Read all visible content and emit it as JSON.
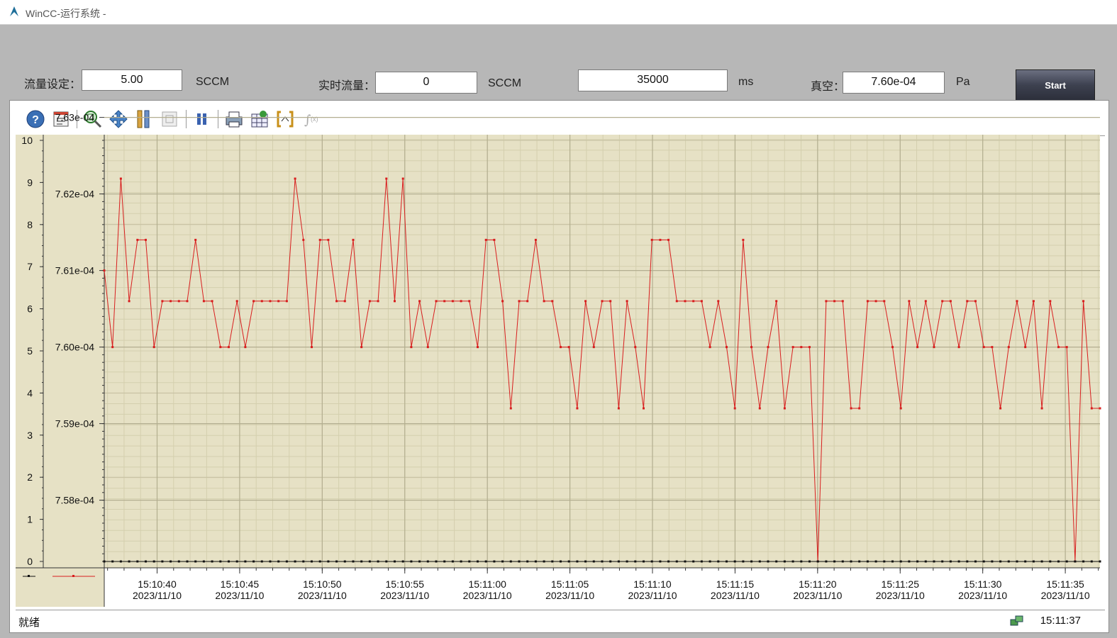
{
  "window": {
    "title": "WinCC-运行系统 -"
  },
  "controls": {
    "flow_set_label": "流量设定：",
    "flow_set_value": "5.00",
    "flow_set_unit": "SCCM",
    "flow_rt_label": "实时流量：",
    "flow_rt_value": "0",
    "flow_rt_unit": "SCCM",
    "time_value": "35000",
    "time_unit": "ms",
    "vacuum_label": "真空：",
    "vacuum_value": "7.60e-04",
    "vacuum_unit": "Pa",
    "start_label": "Start"
  },
  "toolbar": {
    "icons": [
      "help-icon",
      "config-icon",
      "zoom-area-icon",
      "move-icon",
      "zoom-axis-icon",
      "original-view-icon",
      "pause-icon",
      "print-icon",
      "export-icon",
      "select-range-icon",
      "statistics-icon"
    ]
  },
  "status": {
    "text": "就绪",
    "time": "15:11:37"
  },
  "chart_data": {
    "type": "line",
    "y_left": {
      "ticks": [
        "0",
        "1",
        "2",
        "3",
        "4",
        "5",
        "6",
        "7",
        "8",
        "9",
        "10"
      ],
      "range": [
        0,
        10
      ]
    },
    "y_right": {
      "ticks": [
        "7.58e-04",
        "7.59e-04",
        "7.60e-04",
        "7.61e-04",
        "7.62e-04",
        "7.63e-04"
      ],
      "range": [
        0.0007572,
        0.0007627
      ]
    },
    "x_ticks": [
      {
        "time": "15:10:40",
        "date": "2023/11/10"
      },
      {
        "time": "15:10:45",
        "date": "2023/11/10"
      },
      {
        "time": "15:10:50",
        "date": "2023/11/10"
      },
      {
        "time": "15:10:55",
        "date": "2023/11/10"
      },
      {
        "time": "15:11:00",
        "date": "2023/11/10"
      },
      {
        "time": "15:11:05",
        "date": "2023/11/10"
      },
      {
        "time": "15:11:10",
        "date": "2023/11/10"
      },
      {
        "time": "15:11:15",
        "date": "2023/11/10"
      },
      {
        "time": "15:11:20",
        "date": "2023/11/10"
      },
      {
        "time": "15:11:25",
        "date": "2023/11/10"
      },
      {
        "time": "15:11:30",
        "date": "2023/11/10"
      },
      {
        "time": "15:11:35",
        "date": "2023/11/10"
      }
    ],
    "x_range_seconds": {
      "start": "15:10:36.8",
      "end": "15:11:37.1"
    },
    "series": [
      {
        "color": "#d81e1e",
        "axis": "right",
        "values": [
          "7.610e-04",
          "7.600e-04",
          "7.622e-04",
          "7.606e-04",
          "7.614e-04",
          "7.614e-04",
          "7.600e-04",
          "7.606e-04",
          "7.606e-04",
          "7.606e-04",
          "7.606e-04",
          "7.614e-04",
          "7.606e-04",
          "7.606e-04",
          "7.600e-04",
          "7.600e-04",
          "7.606e-04",
          "7.600e-04",
          "7.606e-04",
          "7.606e-04",
          "7.606e-04",
          "7.606e-04",
          "7.606e-04",
          "7.622e-04",
          "7.614e-04",
          "7.600e-04",
          "7.614e-04",
          "7.614e-04",
          "7.606e-04",
          "7.606e-04",
          "7.614e-04",
          "7.600e-04",
          "7.606e-04",
          "7.606e-04",
          "7.622e-04",
          "7.606e-04",
          "7.622e-04",
          "7.600e-04",
          "7.606e-04",
          "7.600e-04",
          "7.606e-04",
          "7.606e-04",
          "7.606e-04",
          "7.606e-04",
          "7.606e-04",
          "7.600e-04",
          "7.614e-04",
          "7.614e-04",
          "7.606e-04",
          "7.592e-04",
          "7.606e-04",
          "7.606e-04",
          "7.614e-04",
          "7.606e-04",
          "7.606e-04",
          "7.600e-04",
          "7.600e-04",
          "7.592e-04",
          "7.606e-04",
          "7.600e-04",
          "7.606e-04",
          "7.606e-04",
          "7.592e-04",
          "7.606e-04",
          "7.600e-04",
          "7.592e-04",
          "7.614e-04",
          "7.614e-04",
          "7.614e-04",
          "7.606e-04",
          "7.606e-04",
          "7.606e-04",
          "7.606e-04",
          "7.600e-04",
          "7.606e-04",
          "7.600e-04",
          "7.592e-04",
          "7.614e-04",
          "7.600e-04",
          "7.592e-04",
          "7.600e-04",
          "7.606e-04",
          "7.592e-04",
          "7.600e-04",
          "7.600e-04",
          "7.600e-04",
          "7.572e-04",
          "7.606e-04",
          "7.606e-04",
          "7.606e-04",
          "7.592e-04",
          "7.592e-04",
          "7.606e-04",
          "7.606e-04",
          "7.606e-04",
          "7.600e-04",
          "7.592e-04",
          "7.606e-04",
          "7.600e-04",
          "7.606e-04",
          "7.600e-04",
          "7.606e-04",
          "7.606e-04",
          "7.600e-04",
          "7.606e-04",
          "7.606e-04",
          "7.600e-04",
          "7.600e-04",
          "7.592e-04",
          "7.600e-04",
          "7.606e-04",
          "7.600e-04",
          "7.606e-04",
          "7.592e-04",
          "7.606e-04",
          "7.600e-04",
          "7.600e-04",
          "7.572e-04",
          "7.606e-04",
          "7.592e-04",
          "7.592e-04"
        ]
      },
      {
        "color": "#111111",
        "axis": "left",
        "values": [
          "0",
          "0",
          "0",
          "0",
          "0",
          "0",
          "0",
          "0",
          "0",
          "0",
          "0",
          "0",
          "0",
          "0",
          "0",
          "0",
          "0",
          "0",
          "0",
          "0",
          "0",
          "0",
          "0",
          "0",
          "0",
          "0",
          "0",
          "0",
          "0",
          "0",
          "0",
          "0",
          "0",
          "0",
          "0",
          "0",
          "0",
          "0",
          "0",
          "0",
          "0",
          "0",
          "0",
          "0",
          "0",
          "0",
          "0",
          "0",
          "0",
          "0",
          "0",
          "0",
          "0",
          "0",
          "0",
          "0",
          "0",
          "0",
          "0",
          "0",
          "0",
          "0",
          "0",
          "0",
          "0",
          "0",
          "0",
          "0",
          "0",
          "0",
          "0",
          "0",
          "0",
          "0",
          "0",
          "0",
          "0",
          "0",
          "0",
          "0",
          "0",
          "0",
          "0",
          "0",
          "0",
          "0",
          "0",
          "0",
          "0",
          "0",
          "0",
          "0",
          "0",
          "0",
          "0",
          "0",
          "0",
          "0",
          "0",
          "0",
          "0",
          "0",
          "0",
          "0",
          "0",
          "0",
          "0",
          "0",
          "0",
          "0",
          "0",
          "0",
          "0",
          "0",
          "0",
          "0",
          "0",
          "0",
          "0",
          "0",
          "0"
        ]
      }
    ]
  }
}
